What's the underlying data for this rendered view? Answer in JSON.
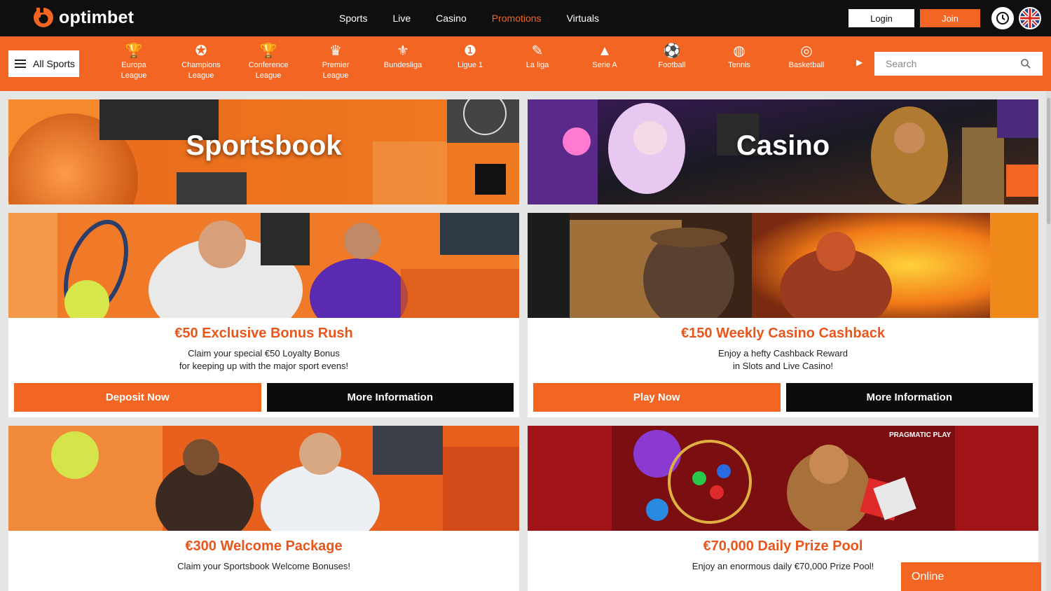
{
  "brand": {
    "name": "optimbet",
    "accent": "#f26522"
  },
  "nav": {
    "items": [
      {
        "label": "Sports"
      },
      {
        "label": "Live"
      },
      {
        "label": "Casino"
      },
      {
        "label": "Promotions",
        "active": true
      },
      {
        "label": "Virtuals"
      }
    ]
  },
  "auth": {
    "login_label": "Login",
    "join_label": "Join"
  },
  "sportsbar": {
    "all_label": "All Sports",
    "items": [
      {
        "label1": "Europa",
        "label2": "League",
        "icon": "europa-league-icon"
      },
      {
        "label1": "Champions",
        "label2": "League",
        "icon": "champions-league-icon"
      },
      {
        "label1": "Conference",
        "label2": "League",
        "icon": "conference-league-icon"
      },
      {
        "label1": "Premier",
        "label2": "League",
        "icon": "premier-league-icon"
      },
      {
        "label1": "Bundesliga",
        "label2": "",
        "icon": "bundesliga-icon"
      },
      {
        "label1": "Ligue 1",
        "label2": "",
        "icon": "ligue1-icon"
      },
      {
        "label1": "La liga",
        "label2": "",
        "icon": "laliga-icon"
      },
      {
        "label1": "Serie A",
        "label2": "",
        "icon": "serie-a-icon"
      },
      {
        "label1": "Football",
        "label2": "",
        "icon": "football-icon"
      },
      {
        "label1": "Tennis",
        "label2": "",
        "icon": "tennis-icon"
      },
      {
        "label1": "Basketball",
        "label2": "",
        "icon": "basketball-icon"
      }
    ],
    "search_placeholder": "Search"
  },
  "heroes": {
    "sportsbook": "Sportsbook",
    "casino": "Casino"
  },
  "promos": [
    {
      "title": "€50 Exclusive Bonus Rush",
      "desc1": "Claim your special €50 Loyalty Bonus",
      "desc2": "for keeping up with the major sport evens!",
      "primary": "Deposit Now",
      "secondary": "More Information"
    },
    {
      "title": "€150 Weekly Casino Cashback",
      "desc1": "Enjoy a hefty Cashback Reward",
      "desc2": "in Slots and Live Casino!",
      "primary": "Play Now",
      "secondary": "More Information"
    },
    {
      "title": "€300 Welcome Package",
      "desc1": "Claim your Sportsbook Welcome Bonuses!",
      "desc2": ""
    },
    {
      "title": "€70,000 Daily Prize Pool",
      "desc1": "Enjoy an enormous daily €70,000 Prize Pool!",
      "desc2": "",
      "badge": "PRAGMATIC PLAY"
    }
  ],
  "chat": {
    "status": "Online"
  }
}
